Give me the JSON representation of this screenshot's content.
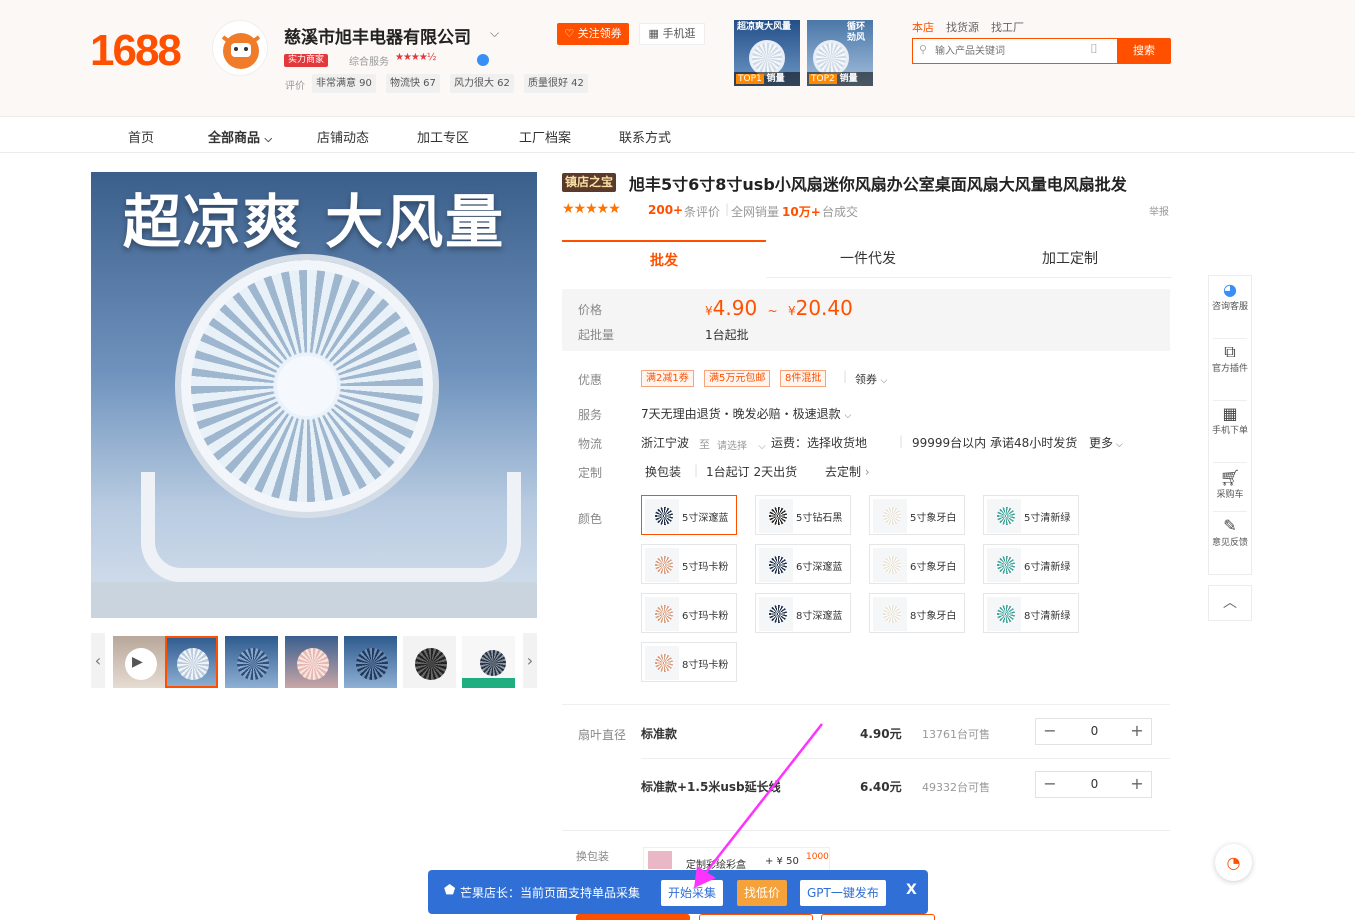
{
  "header": {
    "logo": "1688",
    "shop_name": "慈溪市旭丰电器有限公司",
    "strength_badge": "实力商家",
    "composite_service_label": "综合服务",
    "shop_stars": "★★★★½",
    "eval_label": "评价",
    "eval_chips": [
      "非常满意 90",
      "物流快 67",
      "风力很大 62",
      "质量很好 42"
    ],
    "follow_label": "关注领券",
    "mobile_label": "手机逛",
    "top_products": [
      {
        "title": "超凉爽大风量",
        "rank": "TOP1",
        "rank_suffix": "销量"
      },
      {
        "title": "循环劲风",
        "rank": "TOP2",
        "rank_suffix": "销量"
      }
    ],
    "search_tabs": [
      "本店",
      "找货源",
      "找工厂"
    ],
    "search_placeholder": "输入产品关键词",
    "search_button": "搜索"
  },
  "nav": {
    "items": [
      "首页",
      "全部商品",
      "店铺动态",
      "加工专区",
      "工厂档案",
      "联系方式"
    ]
  },
  "gallery": {
    "headline": "超凉爽 大风量"
  },
  "product": {
    "badge": "镇店之宝",
    "title": "旭丰5寸6寸8寸usb小风扇迷你风扇办公室桌面风扇大风量电风扇批发",
    "stars": "★★★★★",
    "review_count": "200+",
    "review_label": "条评价",
    "sales_label": "全网销量",
    "sales_value": "10万+",
    "sales_unit": "台成交",
    "report": "举报",
    "tabs": [
      "批发",
      "一件代发",
      "加工定制"
    ],
    "price_label": "价格",
    "price_currency": "¥",
    "price_low": "4.90",
    "price_tilde": "~",
    "price_high": "20.40",
    "min_order_label": "起批量",
    "min_order_value": "1台起批",
    "discount_label": "优惠",
    "coupons": [
      "满2减1券",
      "满5万元包邮",
      "8件混批"
    ],
    "coupon_get": "领券",
    "service_label": "服务",
    "service_value": "7天无理由退货・晚发必赔・极速退款",
    "logistics_label": "物流",
    "logistics_origin": "浙江宁波",
    "logistics_to": "至",
    "logistics_select": "请选择",
    "logistics_fee": "运费：选择收货地",
    "logistics_stock": "99999台以内 承诺48小时发货",
    "logistics_more": "更多",
    "custom_label": "定制",
    "custom_pack": "换包装",
    "custom_min": "1台起订 2天出货",
    "custom_go": "去定制",
    "color_label": "颜色",
    "colors": [
      "5寸深邃蓝",
      "5寸钻石黑",
      "5寸象牙白",
      "5寸清新绿",
      "5寸玛卡粉",
      "6寸深邃蓝",
      "6寸象牙白",
      "6寸清新绿",
      "6寸玛卡粉",
      "8寸深邃蓝",
      "8寸象牙白",
      "8寸清新绿",
      "8寸玛卡粉"
    ],
    "blade_label": "扇叶直径",
    "specs": [
      {
        "name": "标准款",
        "price": "4.90元",
        "stock": "13761台可售",
        "qty": "0"
      },
      {
        "name": "标准款+1.5米usb延长线",
        "price": "6.40元",
        "stock": "49332台可售",
        "qty": "0"
      }
    ],
    "package_label": "换包装",
    "package_name": "定制彩绘彩盒",
    "package_price": "+ ¥ 50",
    "package_moq": "1000"
  },
  "side": {
    "items": [
      "咨询客服",
      "官方插件",
      "手机下单",
      "采购车",
      "意见反馈"
    ]
  },
  "plugin": {
    "text": "芒果店长：当前页面支持单品采集",
    "start": "开始采集",
    "lowprice": "找低价",
    "gpt": "GPT一键发布",
    "close": "X"
  },
  "colors": {
    "brand": "#ff5000",
    "plugin_blue": "#2f6fd6",
    "arrow": "#ff33ff"
  }
}
